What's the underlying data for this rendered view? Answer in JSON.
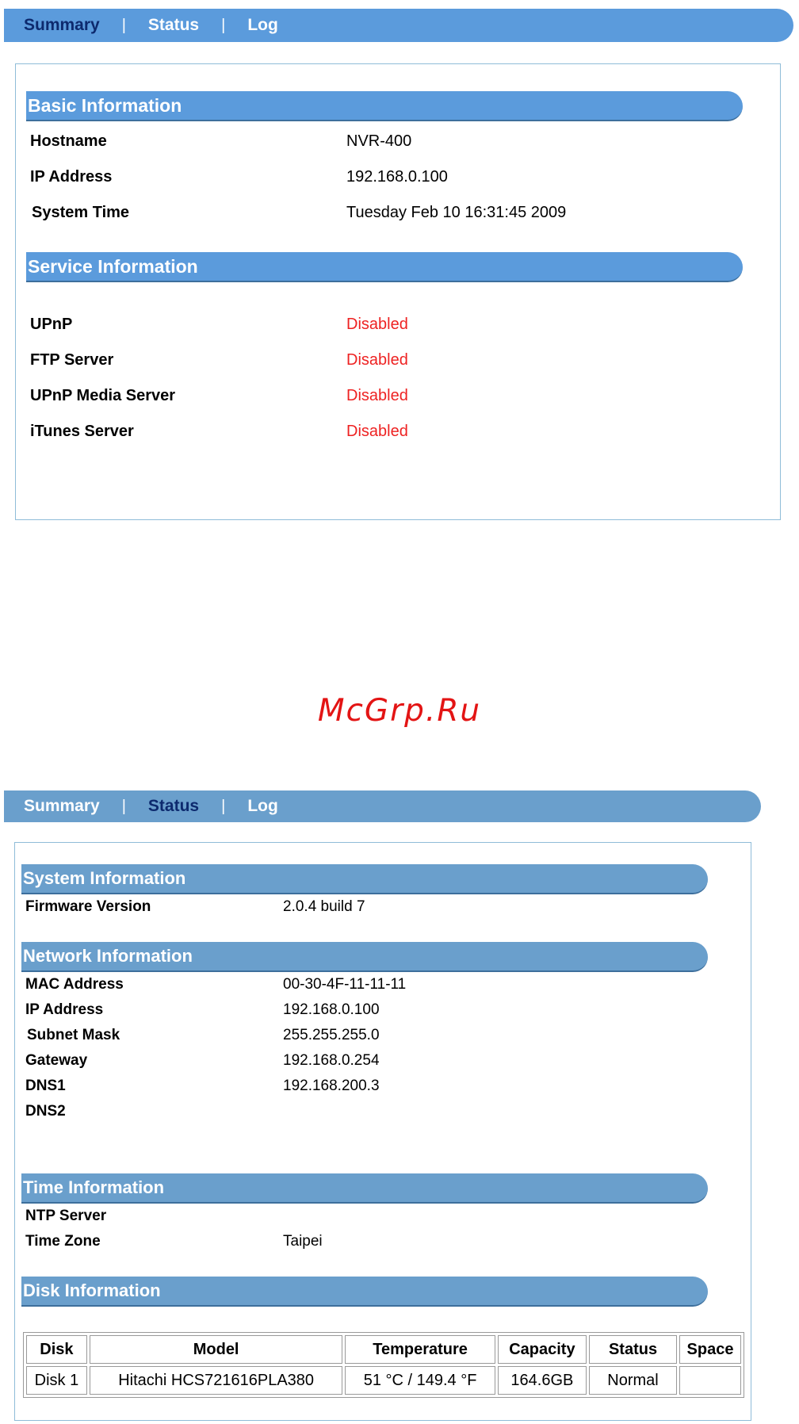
{
  "colors": {
    "tabbar": "#5b9bdc",
    "header": "#5b9bdc",
    "tabbar2": "#6a9fcc",
    "header2": "#6a9fcc",
    "disabled": "#ee2222",
    "active_tab": "#0d2a6e"
  },
  "screen1": {
    "tabs": [
      {
        "label": "Summary",
        "active": true
      },
      {
        "label": "Status",
        "active": false
      },
      {
        "label": "Log",
        "active": false
      }
    ],
    "separator": "|",
    "basic": {
      "title": "Basic Information",
      "rows": [
        {
          "label": "Hostname",
          "value": "NVR-400"
        },
        {
          "label": "IP Address",
          "value": "192.168.0.100"
        },
        {
          "label": "System Time",
          "value": "Tuesday Feb 10 16:31:45 2009"
        }
      ]
    },
    "service": {
      "title": "Service Information",
      "rows": [
        {
          "label": "UPnP",
          "value": "Disabled"
        },
        {
          "label": "FTP Server",
          "value": "Disabled"
        },
        {
          "label": "UPnP Media Server",
          "value": "Disabled"
        },
        {
          "label": "iTunes Server",
          "value": "Disabled"
        }
      ]
    }
  },
  "watermark": "McGrp.Ru",
  "screen2": {
    "tabs": [
      {
        "label": "Summary",
        "active": false
      },
      {
        "label": "Status",
        "active": true
      },
      {
        "label": "Log",
        "active": false
      }
    ],
    "separator": "|",
    "system": {
      "title": "System Information",
      "rows": [
        {
          "label": "Firmware Version",
          "value": "2.0.4 build 7"
        }
      ]
    },
    "network": {
      "title": "Network Information",
      "rows": [
        {
          "label": "MAC Address",
          "value": "00-30-4F-11-11-11"
        },
        {
          "label": "IP Address",
          "value": "192.168.0.100"
        },
        {
          "label": "Subnet Mask",
          "value": "255.255.255.0"
        },
        {
          "label": "Gateway",
          "value": "192.168.0.254"
        },
        {
          "label": "DNS1",
          "value": "192.168.200.3"
        },
        {
          "label": "DNS2",
          "value": ""
        }
      ]
    },
    "time": {
      "title": "Time Information",
      "rows": [
        {
          "label": "NTP Server",
          "value": ""
        },
        {
          "label": "Time Zone",
          "value": "Taipei"
        }
      ]
    },
    "disk": {
      "title": "Disk Information",
      "columns": [
        "Disk",
        "Model",
        "Temperature",
        "Capacity",
        "Status",
        "Space"
      ],
      "rows": [
        [
          "Disk 1",
          "Hitachi HCS721616PLA380",
          "51 °C / 149.4 °F",
          "164.6GB",
          "Normal",
          ""
        ]
      ]
    }
  }
}
